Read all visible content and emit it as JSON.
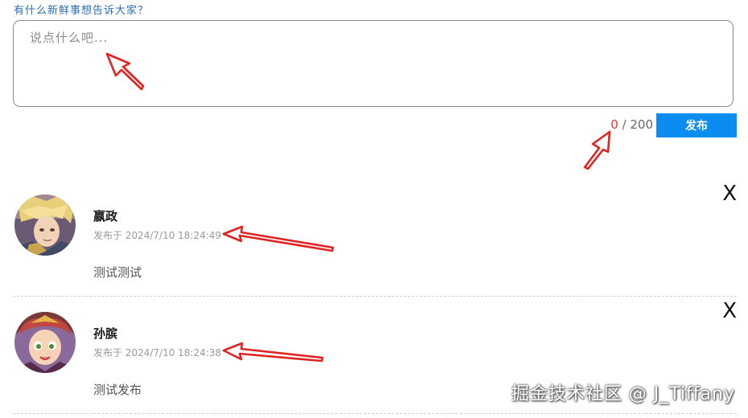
{
  "composer": {
    "prompt_title": "有什么新鲜事想告诉大家？",
    "placeholder": "说点什么吧...",
    "value": "",
    "count_current": "0",
    "count_separator": " / ",
    "count_max": "200",
    "publish_label": "发布"
  },
  "posts": [
    {
      "author": "嬴政",
      "time": "发布于 2024/7/10 18:24:49",
      "content": "测试测试",
      "delete_label": "X"
    },
    {
      "author": "孙膑",
      "time": "发布于 2024/7/10 18:24:38",
      "content": "测试发布",
      "delete_label": "X"
    }
  ],
  "watermark": "掘金技术社区 @ J_Tiffany",
  "colors": {
    "accent": "#0a8cf0",
    "count_current": "#e53935",
    "annotation": "#e02424",
    "prompt_title": "#2a6fb5"
  },
  "icons": {
    "arrows": "red-arrow-icon"
  }
}
